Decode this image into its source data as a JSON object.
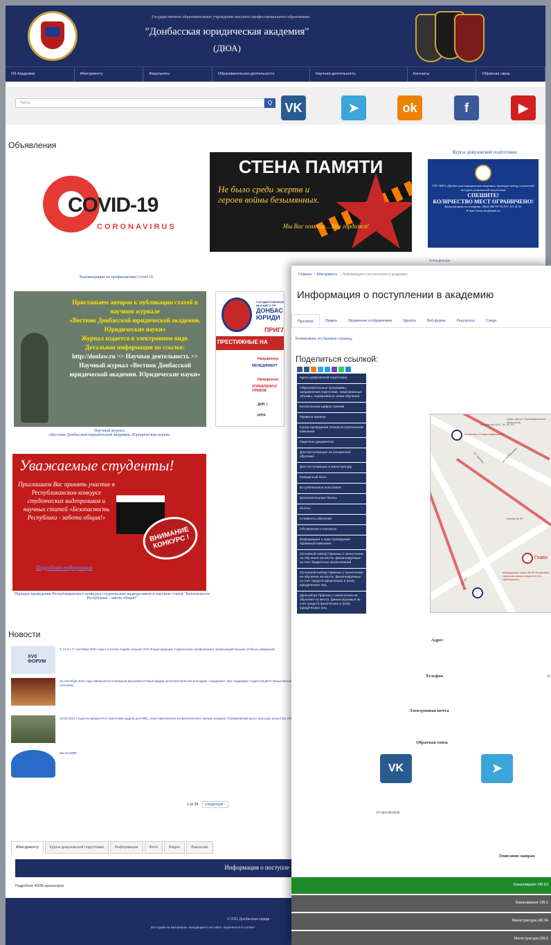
{
  "header": {
    "subtitle": "Государственное образовательное учреждение высшего профессионального образования",
    "title": "\"Донбасская юридическая академия\"",
    "abbr": "(ДЮА)"
  },
  "nav": [
    "Об Академии",
    "Абитуриенту",
    "Факультеты",
    "Образовательная деятельность",
    "Научная деятельность",
    "Контакты",
    "Обратная связь"
  ],
  "search": {
    "placeholder": "Найти",
    "button": "Q"
  },
  "socials": {
    "vk": "VK",
    "tg": "➤",
    "ok": "ok",
    "fb": "f",
    "yt": "▶"
  },
  "announcements": {
    "heading": "Объявления",
    "covid": {
      "title": "COVID-19",
      "sub": "CORONAVIRUS",
      "caption": "Рекомендации по профилактике Covid-19"
    },
    "wall": {
      "title": "СТЕНА ПАМЯТИ",
      "poem": "Не было среди жертв и героев войны безымянных.",
      "quote": "Мы Вас помним... Мы гордимся!"
    },
    "courses": {
      "heading": "Курсы довузовской подготовки",
      "lines": [
        "ГОУ ВПО «Донбасская юридическая академия» проводит набор слушателей",
        "на курсы довузовской подготовки"
      ],
      "hurry": "СПЕШИТЕ!",
      "limited": "КОЛИЧЕСТВО МЕСТ ОГРАНИЧЕНО!",
      "phone": "Консультации по телефону: (062) 300 59 75) 071 311 41 41",
      "email": "E-mail: kursy.dya@mail.ru"
    },
    "mail": "Почта ректора",
    "decree": "Указ Главы ДНР от 24.08.2016 года № 323 «О создании»",
    "journal": {
      "lines": [
        "Приглашаем авторов к публикации статей в научном журнале",
        "«Вестник Донбасской юридической академии. Юридические науки»",
        "Журнал издается в электронном виде.",
        "Детальная информация по ссылке:",
        "http://donlaw.ru => Научная деятельность >> Научный журнал «Вестник Донбасской юридической академии. Юридические науки»"
      ],
      "caption1": "Научный журнал",
      "caption2": "«Вестник Донбасской юридической академии. Юридические науки»"
    },
    "prestige": {
      "top": "ГОСУДАРСТВЕННОЕ ВЫСШЕГО ПР",
      "name": "ДОНБАС ЮРИДИ",
      "invite": "ПРИГЛА",
      "bar": "ПРЕСТИЖНЫЕ НА",
      "r1": "Направлени",
      "r2": "МЕНЕДЖМЕНТ",
      "r3": "Направлени",
      "r4": "УПРАВЛЕНИ И ПРАВОВ",
      "r5": "ДНР, г.",
      "r6": "pdya"
    },
    "contest": {
      "heading": "Уважаемые студенты!",
      "text": "Приглашаем Вас принять участие в Республиканском конкурсе студенческих видеороликов и научных статей «Безопасность Республики - забота общая!»",
      "link": "Подробная информация",
      "badge": "ВНИМАНИЕ КОНКУРС !",
      "caption": "Порядок проведения Республиканского конкурса студенческих видеороликов и научных статей \"Безопасность Республики - забота общая!\""
    }
  },
  "news": {
    "heading": "Новости",
    "items": [
      {
        "badge": "XVII ФОРУМ",
        "text": "С 14 по 17 сентября 2021 года в поселке Седово прошел XVII Форум ведущих студенческих профсоюзных организаций высших учебных заведений"
      },
      {
        "badge": "",
        "text": "16 сентября 2021 года завершился очередной Дальневосточный форум интеллектуальной молодежи «Академия» при поддержке студентов ДЮА Бахыловской Ангелины"
      },
      {
        "badge": "",
        "text": "19.09.2021 студенты факультета подготовки кадров для МВС, участники Военно-патриотического смотра-конкурса \"Юнармейский кросс культуры искусства 2021\""
      },
      {
        "badge": "",
        "text": "Мы за МИР!"
      }
    ],
    "pager": {
      "text": "1 из 38",
      "next": "следующая ›"
    }
  },
  "bottom_tabs": [
    "Абитуриенту",
    "Курсы довузовской подготовки",
    "Информация",
    "Фото",
    "Видео",
    "Вакансии"
  ],
  "info_bar": "Информация о поступле",
  "more": "Подробнее   40036 просмотров",
  "footer": {
    "copy": "© 2021 Донбасская юриди",
    "rights": "Все права на материалы, находящиеся на сайте, охраняются в соответ"
  },
  "overlay": {
    "crumb": [
      "Главная",
      "Абитуриенту",
      "Информация о поступлении в академию"
    ],
    "title": "Информация о поступлении в академию",
    "tabs": [
      "Просмотр",
      "Правка",
      "Управление отображением",
      "Удалить",
      "Веб-форма",
      "Результаты",
      "Следи"
    ],
    "clone": "Клонировать эту базовую страницу",
    "share": "Поделиться ссылкой:",
    "menu": [
      "Курсы довузовской подготовки",
      "Образовательные программы, направления подготовки, лицензионные объемы, нормативные сроки обучения",
      "Контрольные цифры приема",
      "Правила приема",
      "Сроки проведения этапов вступительной кампании",
      "Перечень документов",
      "Для поступающих на ускоренное обучение",
      "Для поступающих в магистратуру",
      "Конкурсный балл",
      "Вступительные испытания",
      "Дополнительные баллы",
      "Льготы",
      "Стоимость обучения",
      "Объявления и контакты",
      "Информация о ходе проведения Приёмной кампании",
      "(Основной набор) Приказы о зачислении на обучение на места, финансируемые за счет бюджетных ассигнований",
      "(Основной набор) Приказы о зачислении на обучение на места, финансируемые за счет средств физических и (или) юридических лиц",
      "(Допнабор) Приказы о зачислении на обучение на места, финансируемые за счет средств физических и (или) юридических лиц"
    ],
    "map": {
      "l1": "Маршруты № 6, 16, 30, 63",
      "l2": "Остановка «Улица Куйбышева»",
      "l3": "Храм святых Первоверховных Апостолов",
      "l4": "ул. Куйбышева",
      "l5": "ул. Артема",
      "l6": "Школа № 60",
      "l7": "Главн",
      "l8": "Маршрутное такси № 96 Остановка «Донская школа искусств» (по требованию)",
      "l9": "ул. Ост"
    },
    "fields": {
      "address": "Адрес",
      "phone": "Телефон",
      "phone_value": "0",
      "email": "Электронная почта",
      "feedback": "Обратная связь"
    },
    "vk": "VK",
    "tg": "➤",
    "views": "14 просмотров",
    "desc": "Описание направ",
    "programs": [
      {
        "label": "Бакалавриат (40.03",
        "color": "#1e8a2a"
      },
      {
        "label": "Бакалавриат (38.0",
        "color": "#5a5a5a"
      },
      {
        "label": "Магистратура (40.04",
        "color": "#5a5a5a"
      },
      {
        "label": "Магистратура (38.0",
        "color": "#5a5a5a"
      }
    ]
  }
}
